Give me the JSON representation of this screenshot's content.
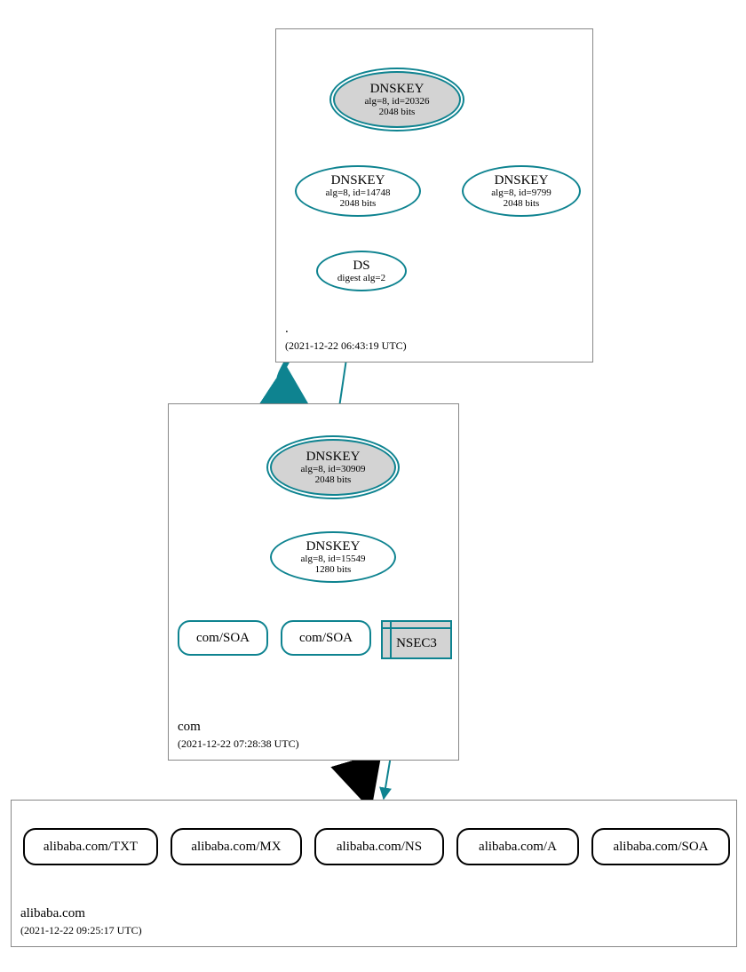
{
  "zones": {
    "root": {
      "label": ".",
      "timestamp": "(2021-12-22 06:43:19 UTC)",
      "dnskey_sep": {
        "title": "DNSKEY",
        "line1": "alg=8, id=20326",
        "line2": "2048 bits"
      },
      "dnskey_a": {
        "title": "DNSKEY",
        "line1": "alg=8, id=14748",
        "line2": "2048 bits"
      },
      "dnskey_b": {
        "title": "DNSKEY",
        "line1": "alg=8, id=9799",
        "line2": "2048 bits"
      },
      "ds": {
        "title": "DS",
        "line1": "digest alg=2"
      }
    },
    "com": {
      "label": "com",
      "timestamp": "(2021-12-22 07:28:38 UTC)",
      "dnskey_sep": {
        "title": "DNSKEY",
        "line1": "alg=8, id=30909",
        "line2": "2048 bits"
      },
      "dnskey_a": {
        "title": "DNSKEY",
        "line1": "alg=8, id=15549",
        "line2": "1280 bits"
      },
      "soa1": "com/SOA",
      "soa2": "com/SOA",
      "nsec3": "NSEC3"
    },
    "alibaba": {
      "label": "alibaba.com",
      "timestamp": "(2021-12-22 09:25:17 UTC)",
      "rr": [
        "alibaba.com/TXT",
        "alibaba.com/MX",
        "alibaba.com/NS",
        "alibaba.com/A",
        "alibaba.com/SOA"
      ]
    }
  }
}
